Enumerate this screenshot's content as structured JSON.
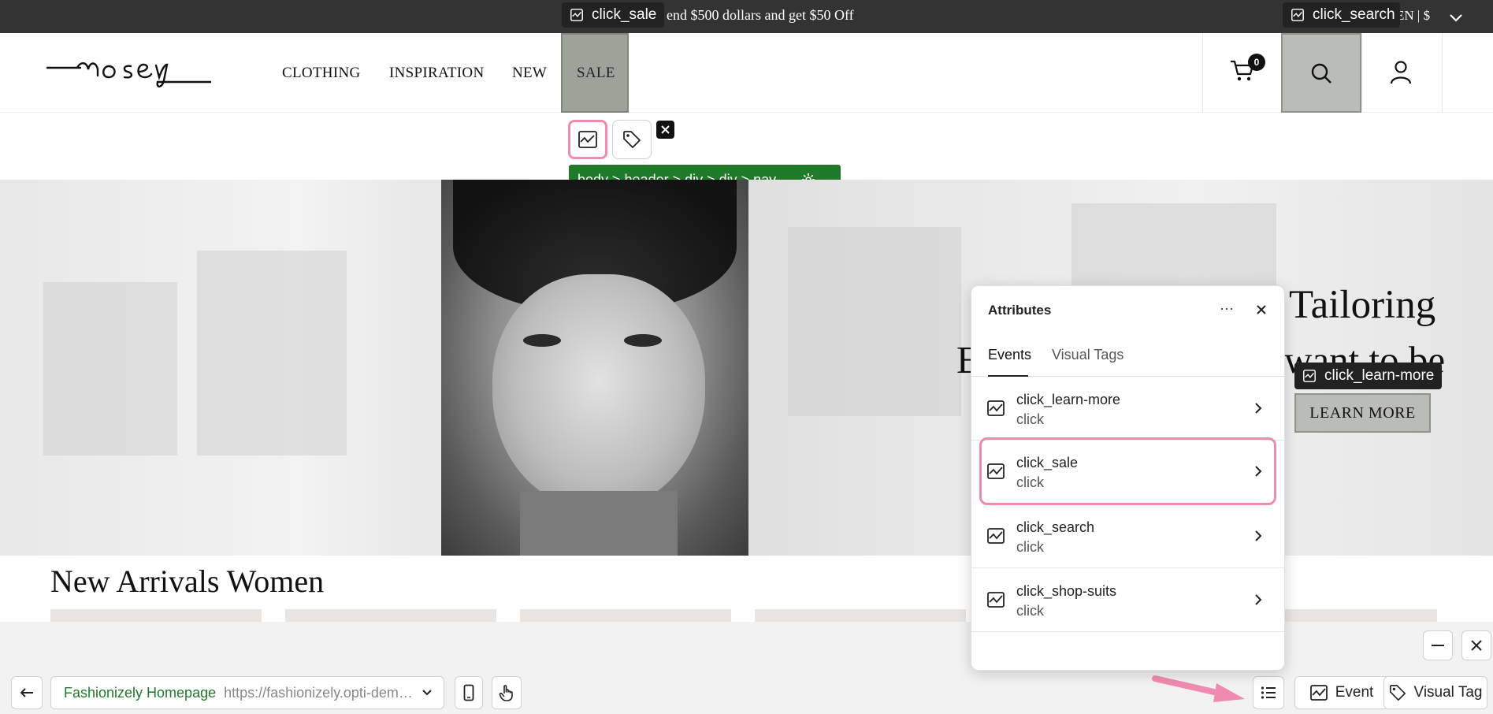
{
  "topbar": {
    "promo": "end $500 dollars and get $50 Off",
    "lang_currency": "EN | $"
  },
  "chips": {
    "sale": "click_sale",
    "search": "click_search",
    "learn_more": "click_learn-more"
  },
  "header": {
    "logo": "mosey",
    "nav": [
      "CLOTHING",
      "INSPIRATION",
      "NEW",
      "SALE"
    ],
    "cart_count": "0"
  },
  "selector_path": "body > header > div > div > nav ...",
  "hero": {
    "title": "Tailoring",
    "subtitle_left": "E",
    "subtitle_right": "want to be",
    "cta": "LEARN MORE"
  },
  "section_title": "New Arrivals Women",
  "panel": {
    "title": "Attributes",
    "more": "···",
    "tabs": [
      "Events",
      "Visual Tags"
    ],
    "events": [
      {
        "name": "click_learn-more",
        "type": "click"
      },
      {
        "name": "click_sale",
        "type": "click"
      },
      {
        "name": "click_search",
        "type": "click"
      },
      {
        "name": "click_shop-suits",
        "type": "click"
      }
    ]
  },
  "bottom": {
    "site_name": "Fashionizely Homepage",
    "url": "https://fashionizely.opti-demo...",
    "event_label": "Event",
    "visual_tag_label": "Visual Tag"
  },
  "icons": {
    "event": "pulse-chart-icon",
    "tag": "tag-icon",
    "accent_pink": "#f08bb0",
    "selector_green": "#1f7a2a"
  }
}
